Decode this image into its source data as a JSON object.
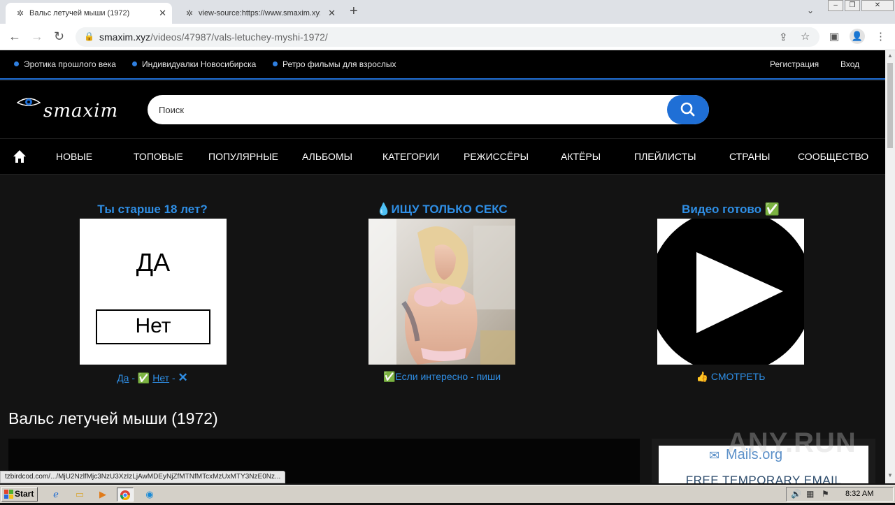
{
  "browser": {
    "tabs": [
      {
        "title": "Вальс летучей мыши (1972)",
        "active": true
      },
      {
        "title": "view-source:https://www.smaxim.xyz",
        "active": false
      }
    ],
    "address": {
      "host": "smaxim.xyz",
      "path": "/videos/47987/vals-letuchey-myshi-1972/"
    }
  },
  "site": {
    "top_links": [
      "Эротика прошлого века",
      "Индивидуалки Новосибирска",
      "Ретро фильмы для взрослых"
    ],
    "register": "Регистрация",
    "login": "Вход",
    "logo": "smaxim",
    "search_placeholder": "Поиск",
    "nav": [
      "НОВЫЕ",
      "ТОПОВЫЕ",
      "ПОПУЛЯРНЫЕ",
      "АЛЬБОМЫ",
      "КАТЕГОРИИ",
      "РЕЖИССЁРЫ",
      "АКТЁРЫ",
      "ПЛЕЙЛИСТЫ",
      "СТРАНЫ",
      "СООБЩЕСТВО"
    ],
    "accent_color": "#1f6fd6"
  },
  "promos": [
    {
      "title": "Ты старше 18 лет?",
      "yes": "ДА",
      "no": "Нет",
      "caption_yes": "Да",
      "caption_no": "Нет",
      "sep": " - ✅ ",
      "sep2": " - ",
      "x": "✕"
    },
    {
      "title": "💧ИЩУ ТОЛЬКО СЕКС",
      "caption": "✅Если интересно - пиши"
    },
    {
      "title": "Видео готово ✅",
      "caption": "👍 СМОТРЕТЬ"
    }
  ],
  "video": {
    "title": "Вальс летучей мыши (1972)"
  },
  "side_ad": {
    "brand": "Mails.org",
    "text": "FREE TEMPORARY EMAIL"
  },
  "watermark": "ANY.RUN",
  "status_url": "tzbirdcod.com/.../MjU2NzlfMjc3NzU3XzIzLjAwMDEyNjZfMTNfMTcxMzUxMTY3NzE0Nz...",
  "taskbar": {
    "start": "Start",
    "clock": "8:32 AM"
  }
}
